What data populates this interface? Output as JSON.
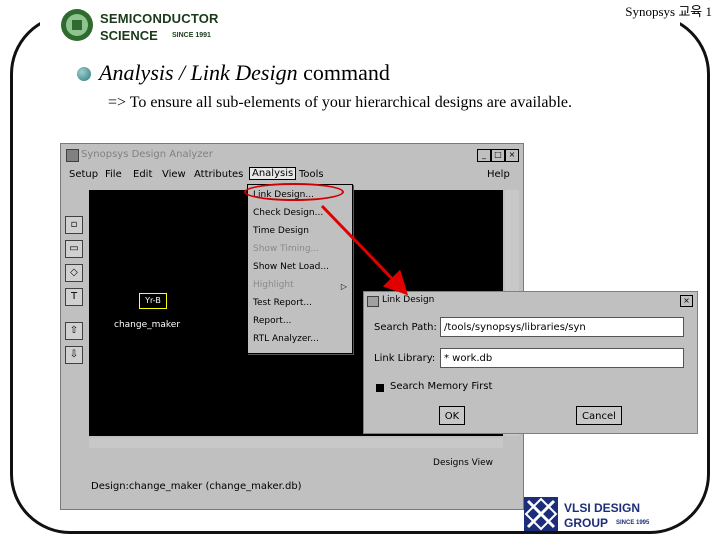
{
  "header": {
    "logo_line1": "SEMICONDUCTOR",
    "logo_line2": "SCIENCE",
    "logo_since": "SINCE 1991",
    "right_text": "Synopsys 교육 1"
  },
  "slide": {
    "heading_italic": "Analysis / Link Design",
    "heading_rest": " command",
    "subline": "=> To ensure all sub-elements of your hierarchical designs are available."
  },
  "window": {
    "title": "Synopsys Design Analyzer",
    "menu": [
      "Setup",
      "File",
      "Edit",
      "View",
      "Attributes",
      "Analysis",
      "Tools",
      "Help"
    ],
    "block_label": "Yr-B",
    "block_caption": "change_maker",
    "status_view": "Designs View",
    "status_design": "Design:change_maker (change_maker.db)"
  },
  "analysis_menu": {
    "items": [
      "Link Design...",
      "Check Design...",
      "Time Design",
      "Show Timing...",
      "Show Net Load...",
      "Highlight",
      "Test Report...",
      "Report...",
      "RTL Analyzer..."
    ],
    "disabled": [
      false,
      false,
      false,
      true,
      false,
      true,
      false,
      false,
      false
    ]
  },
  "dialog": {
    "title": "Link Design",
    "search_path_label": "Search Path:",
    "search_path_value": "/tools/synopsys/libraries/syn",
    "link_library_label": "Link Library:",
    "link_library_value": "* work.db",
    "checkbox_label": "Search Memory First",
    "ok_label": "OK",
    "cancel_label": "Cancel"
  },
  "footer": {
    "vlsi_line1": "VLSI DESIGN",
    "vlsi_line2": "GROUP",
    "vlsi_since": "SINCE 1995"
  },
  "colors": {
    "highlight": "#d00000",
    "arrow": "#e00000",
    "canvas": "#000000",
    "bullet": "#2e7a7c"
  }
}
